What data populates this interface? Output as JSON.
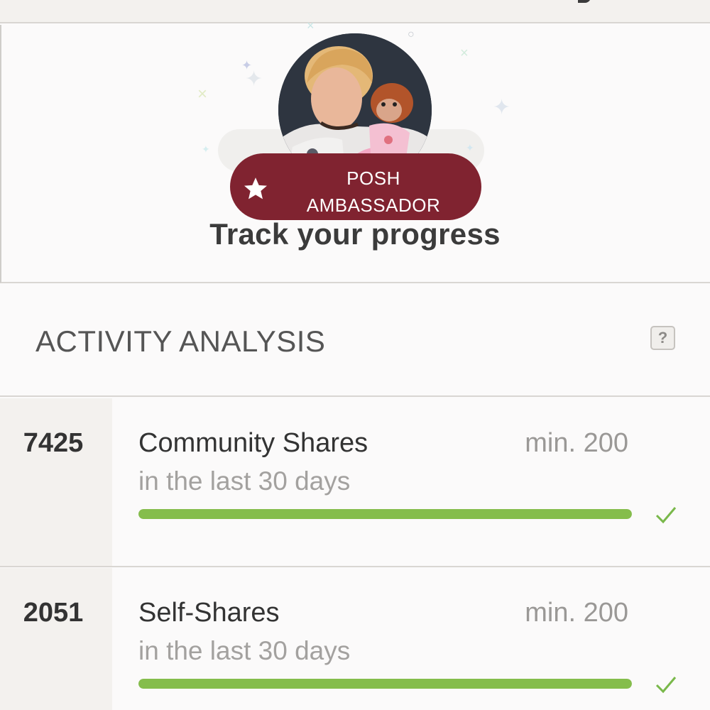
{
  "header": {
    "title": "Track your progress"
  },
  "profile": {
    "badge_line1": "POSH",
    "badge_line2": "AMBASSADOR"
  },
  "activity": {
    "section_title": "ACTIVITY ANALYSIS",
    "help_label": "?",
    "items": [
      {
        "count": "7425",
        "label": "Community Shares",
        "minimum": "min. 200",
        "period": "in the last 30 days",
        "progress": 1.0,
        "status": "check-icon"
      },
      {
        "count": "2051",
        "label": "Self-Shares",
        "minimum": "min. 200",
        "period": "in the last 30 days",
        "progress": 1.0,
        "status": "check-icon"
      }
    ]
  },
  "colors": {
    "badge": "#802330",
    "progress": "#85bd4c",
    "check": "#79b84a"
  }
}
